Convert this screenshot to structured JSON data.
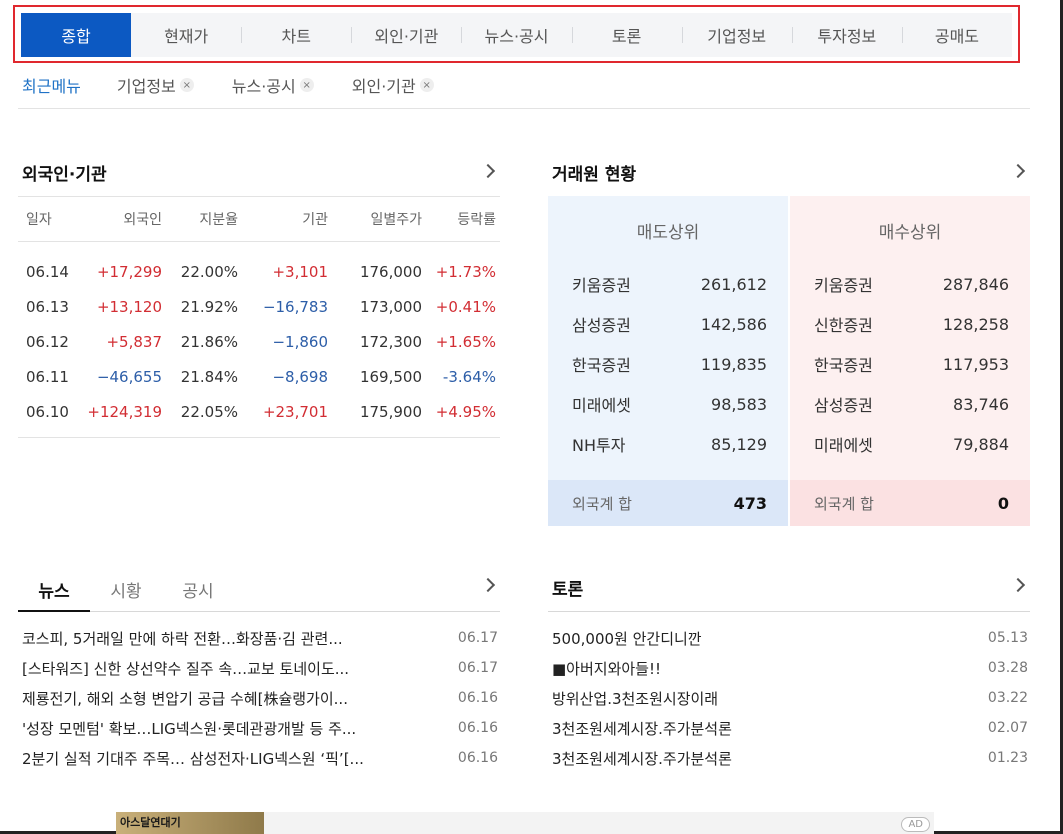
{
  "top_tabs": [
    "종합",
    "현재가",
    "차트",
    "외인·기관",
    "뉴스·공시",
    "토론",
    "기업정보",
    "투자정보",
    "공매도"
  ],
  "recent": {
    "title": "최근메뉴",
    "chips": [
      "기업정보",
      "뉴스·공시",
      "외인·기관"
    ],
    "remove_icon": "×"
  },
  "foreign": {
    "title": "외국인·기관",
    "headers": [
      "일자",
      "외국인",
      "지분율",
      "기관",
      "일별주가",
      "등락률"
    ],
    "rows": [
      {
        "date": "06.14",
        "foreign": "+17,299",
        "ratio": "22.00%",
        "inst": "+3,101",
        "price": "176,000",
        "change": "+1.73%"
      },
      {
        "date": "06.13",
        "foreign": "+13,120",
        "ratio": "21.92%",
        "inst": "−16,783",
        "price": "173,000",
        "change": "+0.41%"
      },
      {
        "date": "06.12",
        "foreign": "+5,837",
        "ratio": "21.86%",
        "inst": "−1,860",
        "price": "172,300",
        "change": "+1.65%"
      },
      {
        "date": "06.11",
        "foreign": "−46,655",
        "ratio": "21.84%",
        "inst": "−8,698",
        "price": "169,500",
        "change": "-3.64%"
      },
      {
        "date": "06.10",
        "foreign": "+124,319",
        "ratio": "22.05%",
        "inst": "+23,701",
        "price": "175,900",
        "change": "+4.95%"
      }
    ]
  },
  "broker": {
    "title": "거래원 현황",
    "sell": {
      "header": "매도상위",
      "rows": [
        {
          "name": "키움증권",
          "qty": "261,612"
        },
        {
          "name": "삼성증권",
          "qty": "142,586"
        },
        {
          "name": "한국증권",
          "qty": "119,835"
        },
        {
          "name": "미래에셋",
          "qty": "98,583"
        },
        {
          "name": "NH투자",
          "qty": "85,129"
        }
      ],
      "sum_label": "외국계 합",
      "sum_value": "473"
    },
    "buy": {
      "header": "매수상위",
      "rows": [
        {
          "name": "키움증권",
          "qty": "287,846"
        },
        {
          "name": "신한증권",
          "qty": "128,258"
        },
        {
          "name": "한국증권",
          "qty": "117,953"
        },
        {
          "name": "삼성증권",
          "qty": "83,746"
        },
        {
          "name": "미래에셋",
          "qty": "79,884"
        }
      ],
      "sum_label": "외국계 합",
      "sum_value": "0"
    }
  },
  "news": {
    "tabs": [
      "뉴스",
      "시황",
      "공시"
    ],
    "items": [
      {
        "title": "코스피, 5거래일 만에 하락 전환…화장품·김 관련...",
        "date": "06.17"
      },
      {
        "title": "[스타워즈] 신한 상선약수 질주 속…교보 토네이도...",
        "date": "06.17"
      },
      {
        "title": "제룡전기, 해외 소형 변압기 공급 수혜[株슐랭가이...",
        "date": "06.16"
      },
      {
        "title": "'성장 모멘텀' 확보…LIG넥스원·롯데관광개발 등 주...",
        "date": "06.16"
      },
      {
        "title": "2분기 실적 기대주 주목… 삼성전자·LIG넥스원 ‘픽’[...",
        "date": "06.16"
      }
    ]
  },
  "debate": {
    "title": "토론",
    "items": [
      {
        "title": "500,000원 안간디니깐",
        "date": "05.13"
      },
      {
        "title": "■아버지와아들!!",
        "date": "03.28"
      },
      {
        "title": "방위산업.3천조원시장이래",
        "date": "03.22"
      },
      {
        "title": "3천조원세계시장.주가분석론",
        "date": "02.07"
      },
      {
        "title": "3천조원세계시장.주가분석론",
        "date": "01.23"
      }
    ]
  },
  "ad": {
    "banner_text": "아스달연대기",
    "badge": "AD"
  },
  "colors": {
    "accent": "#0c59c2",
    "up": "#d22d33",
    "down": "#2d5ea8",
    "highlight_border": "#e0282e"
  }
}
